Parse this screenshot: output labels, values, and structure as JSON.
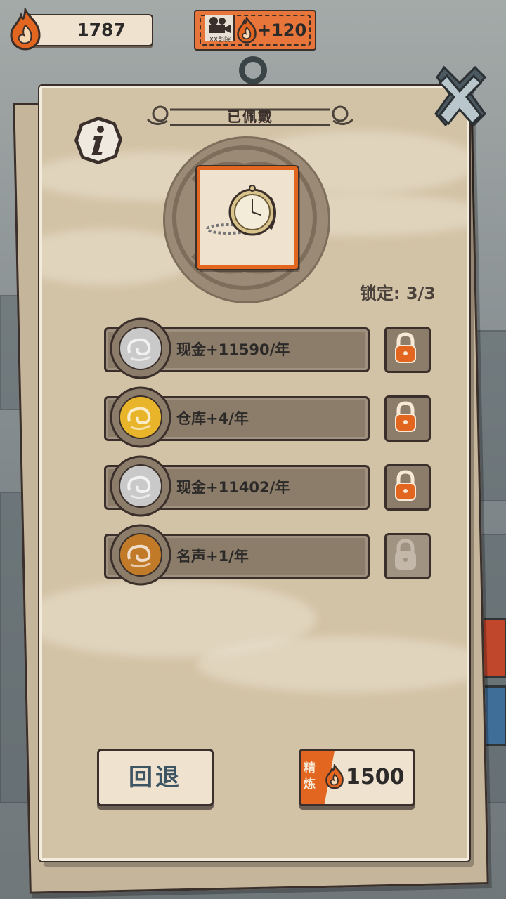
{
  "currency": {
    "amount": "1787",
    "icon": "flame-icon"
  },
  "ad_ticket": {
    "label": "XX影院",
    "reward": "+120",
    "icon": "camera-icon"
  },
  "panel": {
    "title": "已佩戴",
    "lock_status": "锁定: 3/3",
    "equipped_item": "pocket-watch-icon"
  },
  "attributes": [
    {
      "text": "现金+11590/年",
      "tier": "silver",
      "locked": true
    },
    {
      "text": "仓库+4/年",
      "tier": "gold",
      "locked": true
    },
    {
      "text": "现金+11402/年",
      "tier": "silver",
      "locked": true
    },
    {
      "text": "名声+1/年",
      "tier": "bronze",
      "locked": false
    }
  ],
  "buttons": {
    "back_label": "回退",
    "refine_tag": "精炼",
    "refine_cost": "1500"
  },
  "colors": {
    "accent": "#e2661f",
    "panel": "#d3c3a6",
    "silver": "#c9c9c9",
    "gold": "#e8b52a",
    "bronze": "#c07a28"
  }
}
